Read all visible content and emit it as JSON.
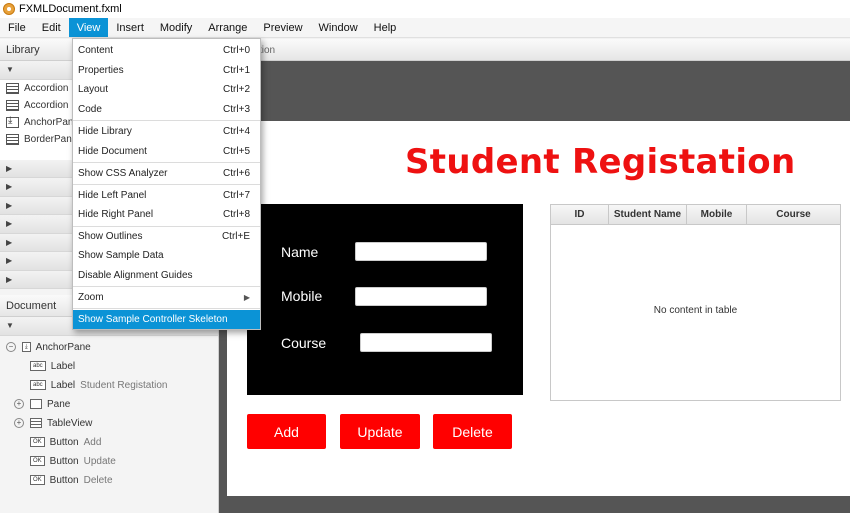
{
  "window": {
    "title": "FXMLDocument.fxml"
  },
  "menubar": [
    "File",
    "Edit",
    "View",
    "Insert",
    "Modify",
    "Arrange",
    "Preview",
    "Window",
    "Help"
  ],
  "editor_tab_fragment": "tion",
  "library": {
    "header": "Library",
    "items": [
      "Accordion",
      "Accordion",
      "AnchorPane",
      "BorderPane"
    ]
  },
  "document": {
    "header": "Document",
    "tree": [
      {
        "icon": "AP",
        "label": "AnchorPane",
        "sub": ""
      },
      {
        "icon": "abc",
        "label": "Label",
        "sub": ""
      },
      {
        "icon": "abc",
        "label": "Label",
        "sub": "Student Registation"
      },
      {
        "icon": "",
        "label": "Pane",
        "sub": ""
      },
      {
        "icon": "tbl",
        "label": "TableView",
        "sub": ""
      },
      {
        "icon": "OK",
        "label": "Button",
        "sub": "Add"
      },
      {
        "icon": "OK",
        "label": "Button",
        "sub": "Update"
      },
      {
        "icon": "OK",
        "label": "Button",
        "sub": "Delete"
      }
    ]
  },
  "view_menu": [
    {
      "label": "Content",
      "shortcut": "Ctrl+0"
    },
    {
      "label": "Properties",
      "shortcut": "Ctrl+1"
    },
    {
      "label": "Layout",
      "shortcut": "Ctrl+2"
    },
    {
      "label": "Code",
      "shortcut": "Ctrl+3"
    },
    {
      "label": "Hide Library",
      "shortcut": "Ctrl+4"
    },
    {
      "label": "Hide Document",
      "shortcut": "Ctrl+5"
    },
    {
      "label": "Show CSS Analyzer",
      "shortcut": "Ctrl+6"
    },
    {
      "label": "Hide Left Panel",
      "shortcut": "Ctrl+7"
    },
    {
      "label": "Hide Right Panel",
      "shortcut": "Ctrl+8"
    },
    {
      "label": "Show Outlines",
      "shortcut": "Ctrl+E"
    },
    {
      "label": "Show Sample Data",
      "shortcut": ""
    },
    {
      "label": "Disable Alignment Guides",
      "shortcut": ""
    },
    {
      "label": "Zoom",
      "shortcut": ""
    },
    {
      "label": "Show Sample Controller Skeleton",
      "shortcut": ""
    }
  ],
  "form": {
    "heading": "Student Registation",
    "labels": {
      "name": "Name",
      "mobile": "Mobile",
      "course": "Course"
    },
    "buttons": {
      "add": "Add",
      "update": "Update",
      "delete": "Delete"
    }
  },
  "table": {
    "columns": [
      "ID",
      "Student Name",
      "Mobile",
      "Course"
    ],
    "empty_message": "No content in table"
  },
  "colors": {
    "accent": "#0b93d6",
    "heading": "#ee1111",
    "button": "#ff0000"
  }
}
